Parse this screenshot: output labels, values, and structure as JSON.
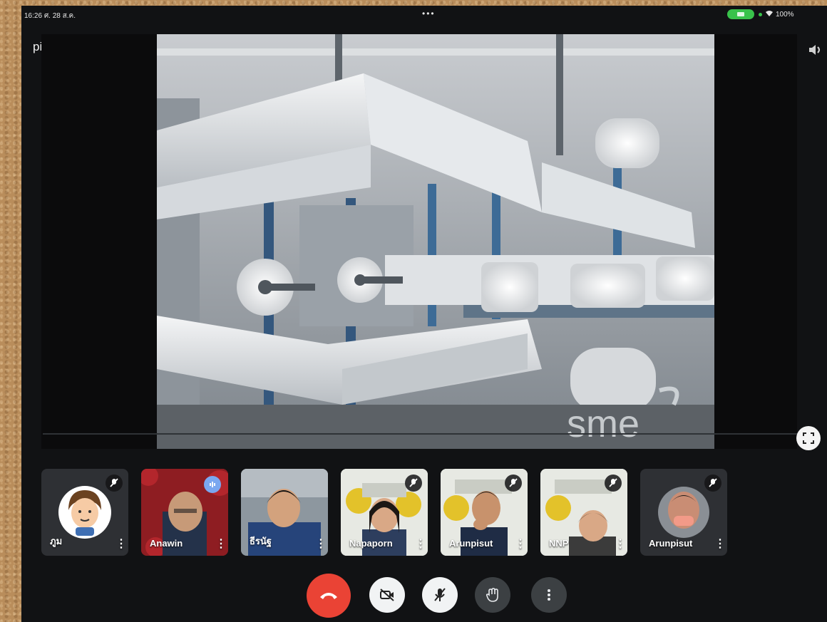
{
  "status_bar": {
    "time": "16:26",
    "date": "ศ. 28 ส.ค.",
    "more": "•••",
    "battery": "100%"
  },
  "meeting": {
    "code": "pip-xjfo-jkw",
    "code_chevron": "›"
  },
  "video": {
    "watermark": "sme"
  },
  "participants": [
    {
      "name": "ภูม",
      "muted": true
    },
    {
      "name": "Anawin",
      "muted": false,
      "speaking": true
    },
    {
      "name": "ธีรนัฐ",
      "muted": false
    },
    {
      "name": "Napaporn",
      "muted": true
    },
    {
      "name": "Arunpisut",
      "muted": true
    },
    {
      "name": "NNP",
      "muted": true
    },
    {
      "name": "Arunpisut",
      "muted": true
    }
  ],
  "controls": {
    "kebab": "⋮"
  },
  "colors": {
    "end_call": "#ea4335",
    "control_bg": "#3c4043",
    "speaking": "#7aa7f0",
    "battery": "#39c24b"
  },
  "icons": [
    "camera-flip-icon",
    "audio-output-icon",
    "fullscreen-icon",
    "mic-off-icon",
    "end-call-icon",
    "camera-off-icon",
    "hand-raise-icon",
    "more-vert-icon"
  ]
}
